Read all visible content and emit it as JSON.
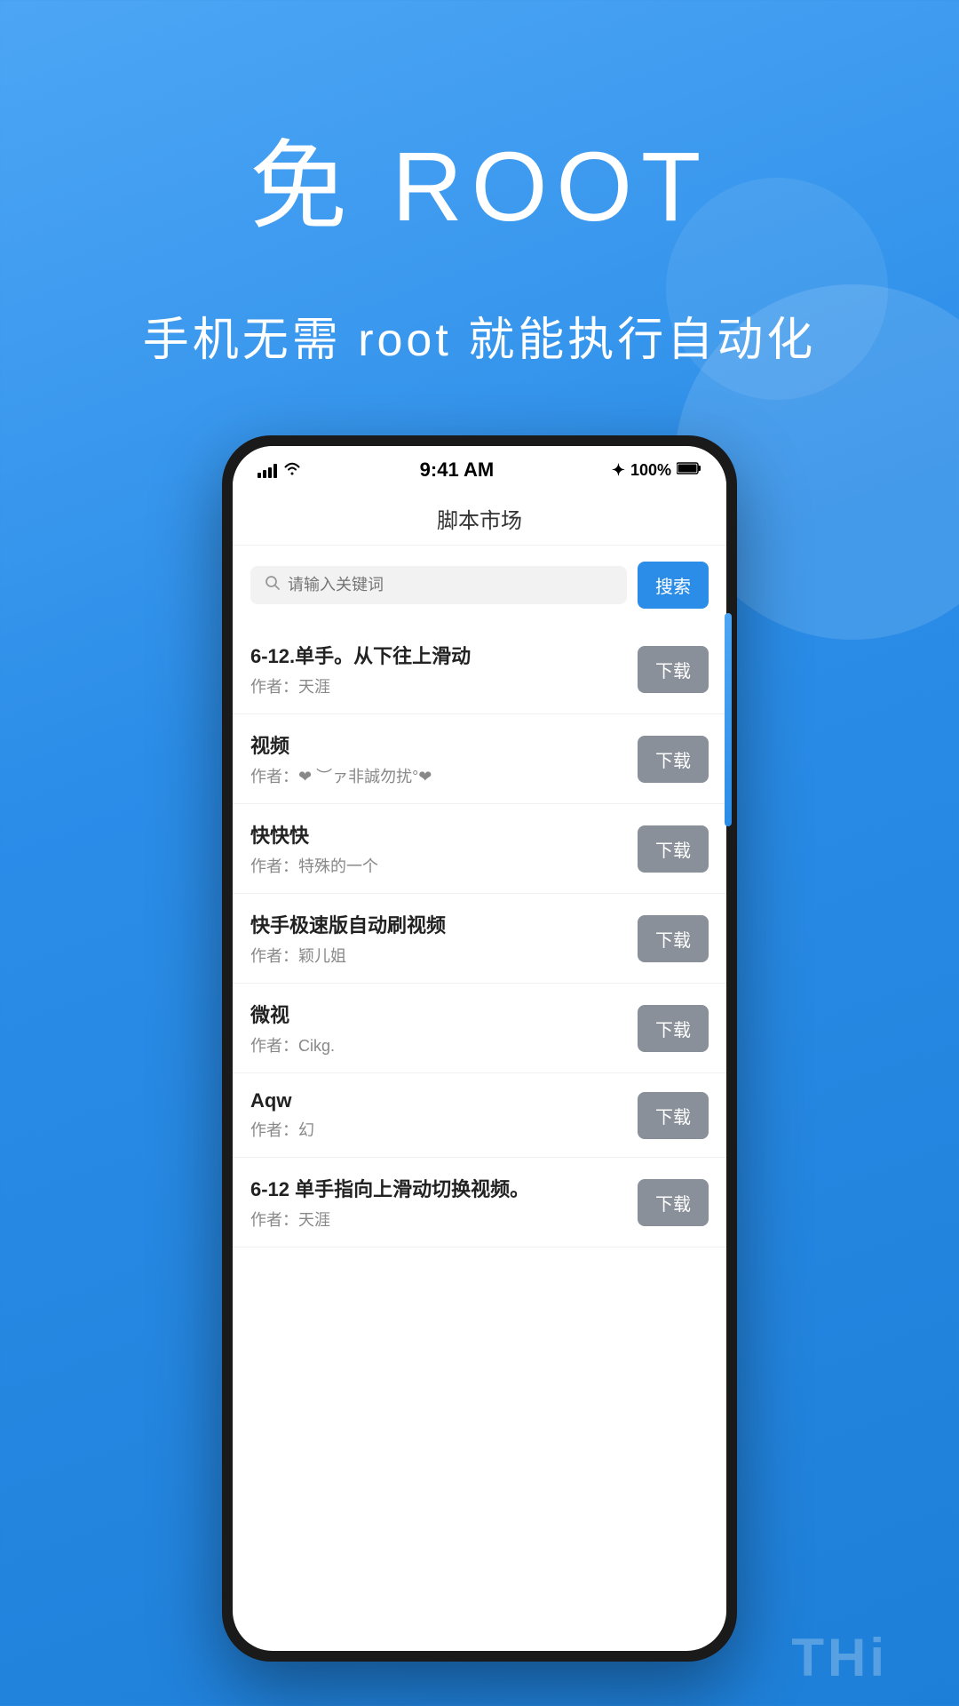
{
  "background": {
    "gradient_start": "#4da6f5",
    "gradient_end": "#1e7fd8"
  },
  "hero": {
    "title": "免 ROOT",
    "subtitle": "手机无需 root 就能执行自动化"
  },
  "phone": {
    "status_bar": {
      "time": "9:41 AM",
      "battery": "100%",
      "bluetooth": "✦"
    },
    "header": {
      "title": "脚本市场"
    },
    "search": {
      "placeholder": "请输入关键词",
      "button_label": "搜索"
    },
    "items": [
      {
        "title": "6-12.单手。从下往上滑动",
        "author_prefix": "作者：",
        "author": "天涯",
        "download_label": "下载"
      },
      {
        "title": "视频",
        "author_prefix": "作者：",
        "author": "❤ ︶ァ非誠勿扰°❤",
        "download_label": "下载"
      },
      {
        "title": "快快快",
        "author_prefix": "作者：",
        "author": "特殊的一个",
        "download_label": "下载"
      },
      {
        "title": "快手极速版自动刷视频",
        "author_prefix": "作者：",
        "author": "颖儿姐",
        "download_label": "下载"
      },
      {
        "title": "微视",
        "author_prefix": "作者：",
        "author": "Cikg.",
        "download_label": "下载"
      },
      {
        "title": "Aqw",
        "author_prefix": "作者：",
        "author": "幻",
        "download_label": "下载"
      },
      {
        "title": "6-12 单手指向上滑动切换视频。",
        "author_prefix": "作者：",
        "author": "天涯",
        "download_label": "下载"
      }
    ]
  },
  "bottom_text": "THi"
}
